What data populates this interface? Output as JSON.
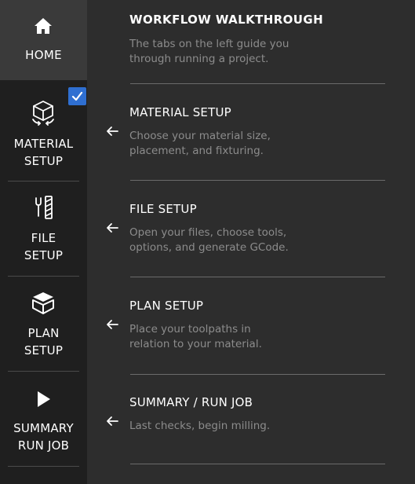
{
  "sidebar": {
    "home": {
      "label": "HOME",
      "icon": "home-icon"
    },
    "items": [
      {
        "label1": "MATERIAL",
        "label2": "SETUP",
        "icon": "material-cube-icon",
        "completed": true
      },
      {
        "label1": "FILE",
        "label2": "SETUP",
        "icon": "tools-icon"
      },
      {
        "label1": "PLAN",
        "label2": "SETUP",
        "icon": "box-icon"
      },
      {
        "label1": "SUMMARY",
        "label2": "RUN JOB",
        "icon": "play-icon"
      }
    ]
  },
  "main": {
    "heading": "WORKFLOW WALKTHROUGH",
    "intro": [
      "The tabs on the left guide you",
      "through running a project."
    ],
    "sections": [
      {
        "title": "MATERIAL SETUP",
        "desc": [
          "Choose your material size,",
          "placement, and fixturing."
        ]
      },
      {
        "title": "FILE SETUP",
        "desc": [
          "Open your files, choose tools,",
          "options, and generate GCode."
        ]
      },
      {
        "title": "PLAN SETUP",
        "desc": [
          "Place your toolpaths in",
          "relation to your material."
        ]
      },
      {
        "title": "SUMMARY / RUN JOB",
        "desc": [
          "Last checks, begin milling."
        ]
      }
    ]
  },
  "colors": {
    "background": "#2d2d2d",
    "sidebar": "#1f1f1f",
    "home_active": "#3a3a3a",
    "accent_check": "#2f6fd1",
    "desc_text": "#8c8c8c"
  }
}
